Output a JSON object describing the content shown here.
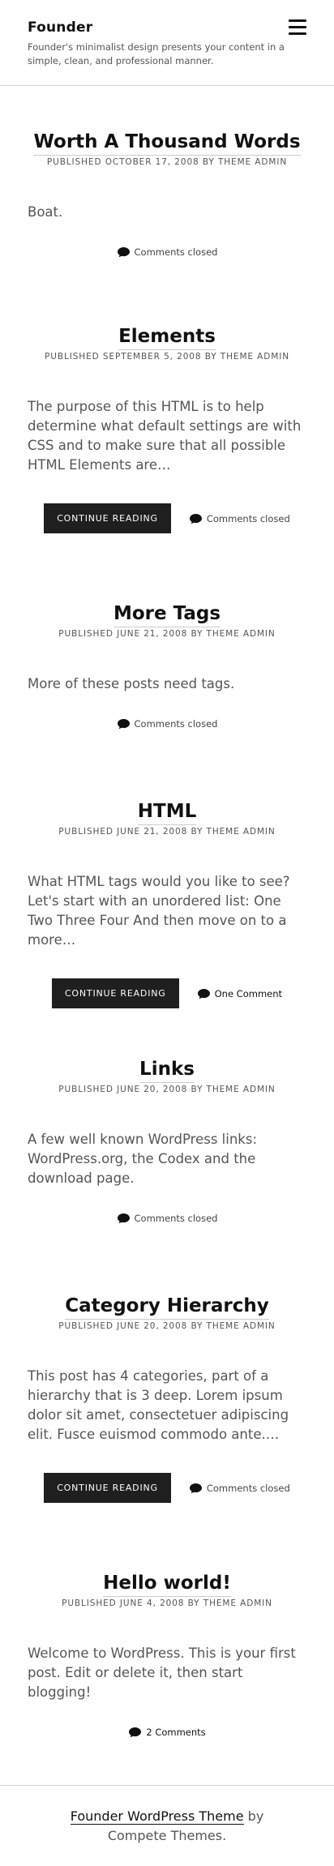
{
  "header": {
    "site_title": "Founder",
    "tagline": "Founder's minimalist design presents your content in a simple, clean, and professional manner."
  },
  "posts": [
    {
      "title": "Worth A Thousand Words",
      "meta_prefix": "Published",
      "date": "October 17, 2008",
      "by": "by",
      "author": "Theme Admin",
      "excerpt": "Boat.",
      "continue_label": "",
      "comments": "Comments closed"
    },
    {
      "title": "Elements",
      "meta_prefix": "Published",
      "date": "September 5, 2008",
      "by": "by",
      "author": "Theme Admin",
      "excerpt": "The purpose of this HTML is to help determine what default settings are with CSS and to make sure that all possible HTML Elements are…",
      "continue_label": "Continue Reading",
      "comments": "Comments closed"
    },
    {
      "title": "More Tags",
      "meta_prefix": "Published",
      "date": "June 21, 2008",
      "by": "by",
      "author": "Theme Admin",
      "excerpt": "More of these posts need tags.",
      "continue_label": "",
      "comments": "Comments closed"
    },
    {
      "title": "HTML",
      "meta_prefix": "Published",
      "date": "June 21, 2008",
      "by": "by",
      "author": "Theme Admin",
      "excerpt": "What HTML tags would you like to see? Let's start with an unordered list: One Two Three Four And then move on to a more…",
      "continue_label": "Continue Reading",
      "comments": "One Comment"
    },
    {
      "title": "Links",
      "meta_prefix": "Published",
      "date": "June 20, 2008",
      "by": "by",
      "author": "Theme Admin",
      "excerpt": "A few well known WordPress links: WordPress.org, the Codex and the download page.",
      "continue_label": "",
      "comments": "Comments closed"
    },
    {
      "title": "Category Hierarchy",
      "meta_prefix": "Published",
      "date": "June 20, 2008",
      "by": "by",
      "author": "Theme Admin",
      "excerpt": "This post has 4 categories, part of a hierarchy that is 3 deep. Lorem ipsum dolor sit amet, consectetuer adipiscing elit. Fusce euismod commodo ante.…",
      "continue_label": "Continue Reading",
      "comments": "Comments closed"
    },
    {
      "title": "Hello world!",
      "meta_prefix": "Published",
      "date": "June 4, 2008",
      "by": "by",
      "author": "Theme Admin",
      "excerpt": "Welcome to WordPress. This is your first post. Edit or delete it, then start blogging!",
      "continue_label": "",
      "comments": "2 Comments"
    }
  ],
  "footer": {
    "theme_link": "Founder WordPress Theme",
    "suffix": " by Compete Themes."
  },
  "colors": {
    "button_bg": "#1f1f1f",
    "text": "#555555",
    "title": "#111111",
    "divider": "#d4d4d4"
  },
  "icons": {
    "menu": "hamburger-menu-icon",
    "comment": "comment-bubble-icon"
  }
}
